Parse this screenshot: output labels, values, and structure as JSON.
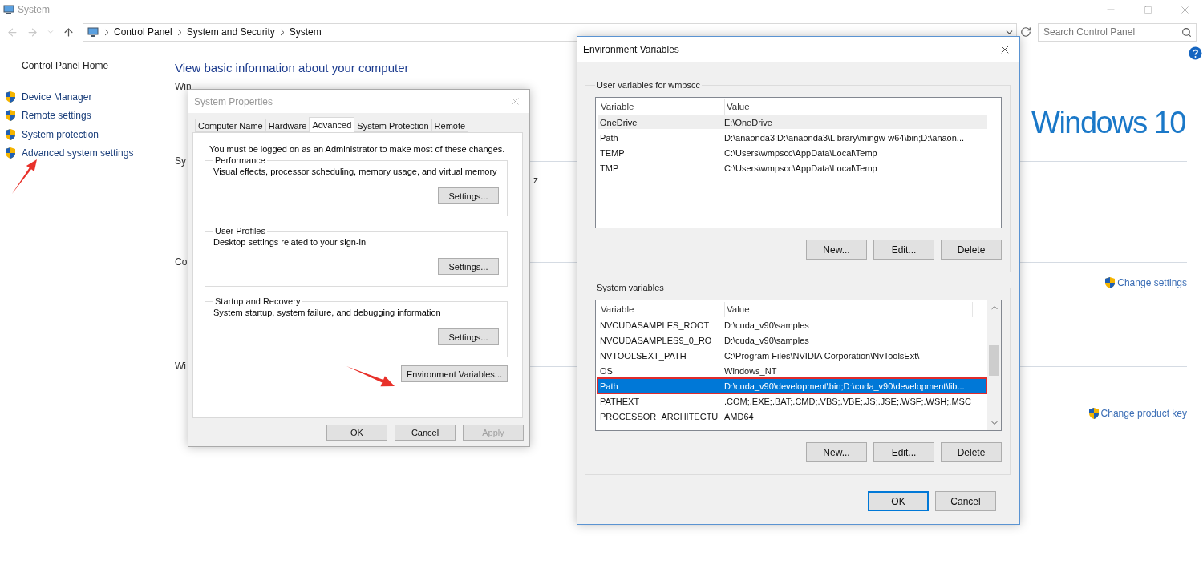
{
  "window": {
    "title": "System"
  },
  "address_bar": {
    "breadcrumb": [
      "Control Panel",
      "System and Security",
      "System"
    ]
  },
  "search": {
    "placeholder": "Search Control Panel"
  },
  "sidebar": {
    "home": "Control Panel Home",
    "items": [
      {
        "label": "Device Manager"
      },
      {
        "label": "Remote settings"
      },
      {
        "label": "System protection"
      },
      {
        "label": "Advanced system settings"
      }
    ]
  },
  "main": {
    "heading": "View basic information about your computer",
    "sections": [
      {
        "label": "Win",
        "logo": "Windows 10"
      },
      {
        "label": "Sy",
        "detail": "z"
      },
      {
        "label": "Co",
        "link": "Change settings"
      },
      {
        "label": "Wi",
        "link": "Change product key"
      }
    ]
  },
  "system_properties": {
    "title": "System Properties",
    "tabs": [
      {
        "label": "Computer Name",
        "selected": false
      },
      {
        "label": "Hardware",
        "selected": false
      },
      {
        "label": "Advanced",
        "selected": true
      },
      {
        "label": "System Protection",
        "selected": false
      },
      {
        "label": "Remote",
        "selected": false
      }
    ],
    "notice": "You must be logged on as an Administrator to make most of these changes.",
    "groups": [
      {
        "title": "Performance",
        "description": "Visual effects, processor scheduling, memory usage, and virtual memory",
        "button": "Settings..."
      },
      {
        "title": "User Profiles",
        "description": "Desktop settings related to your sign-in",
        "button": "Settings..."
      },
      {
        "title": "Startup and Recovery",
        "description": "System startup, system failure, and debugging information",
        "button": "Settings..."
      }
    ],
    "env_button": "Environment Variables...",
    "buttons": [
      {
        "label": "OK",
        "disabled": false
      },
      {
        "label": "Cancel",
        "disabled": false
      },
      {
        "label": "Apply",
        "disabled": true
      }
    ]
  },
  "environment_variables": {
    "title": "Environment Variables",
    "user_vars": {
      "title": "User variables for wmpscc",
      "focused": false,
      "columns": [
        "Variable",
        "Value"
      ],
      "rows": [
        {
          "variable": "OneDrive",
          "value": "E:\\OneDrive",
          "selected": true,
          "highlighted": false
        },
        {
          "variable": "Path",
          "value": "D:\\anaonda3;D:\\anaonda3\\Library\\mingw-w64\\bin;D:\\anaon...",
          "selected": false,
          "highlighted": false
        },
        {
          "variable": "TEMP",
          "value": "C:\\Users\\wmpscc\\AppData\\Local\\Temp",
          "selected": false,
          "highlighted": false
        },
        {
          "variable": "TMP",
          "value": "C:\\Users\\wmpscc\\AppData\\Local\\Temp",
          "selected": false,
          "highlighted": false
        }
      ],
      "buttons": [
        "New...",
        "Edit...",
        "Delete"
      ]
    },
    "system_vars": {
      "title": "System variables",
      "focused": true,
      "columns": [
        "Variable",
        "Value"
      ],
      "rows": [
        {
          "variable": "NVCUDASAMPLES_ROOT",
          "value": "D:\\cuda_v90\\samples",
          "selected": false,
          "highlighted": false
        },
        {
          "variable": "NVCUDASAMPLES9_0_RO",
          "value": "D:\\cuda_v90\\samples",
          "selected": false,
          "highlighted": false
        },
        {
          "variable": "NVTOOLSEXT_PATH",
          "value": "C:\\Program Files\\NVIDIA Corporation\\NvToolsExt\\",
          "selected": false,
          "highlighted": false
        },
        {
          "variable": "OS",
          "value": "Windows_NT",
          "selected": false,
          "highlighted": false
        },
        {
          "variable": "Path",
          "value": "D:\\cuda_v90\\development\\bin;D:\\cuda_v90\\development\\lib...",
          "selected": true,
          "highlighted": true
        },
        {
          "variable": "PATHEXT",
          "value": ".COM;.EXE;.BAT;.CMD;.VBS;.VBE;.JS;.JSE;.WSF;.WSH;.MSC",
          "selected": false,
          "highlighted": false
        },
        {
          "variable": "PROCESSOR_ARCHITECTU",
          "value": "AMD64",
          "selected": false,
          "highlighted": false
        }
      ],
      "buttons": [
        "New...",
        "Edit...",
        "Delete"
      ]
    },
    "buttons": [
      {
        "label": "OK",
        "default": true
      },
      {
        "label": "Cancel",
        "default": false
      }
    ]
  }
}
